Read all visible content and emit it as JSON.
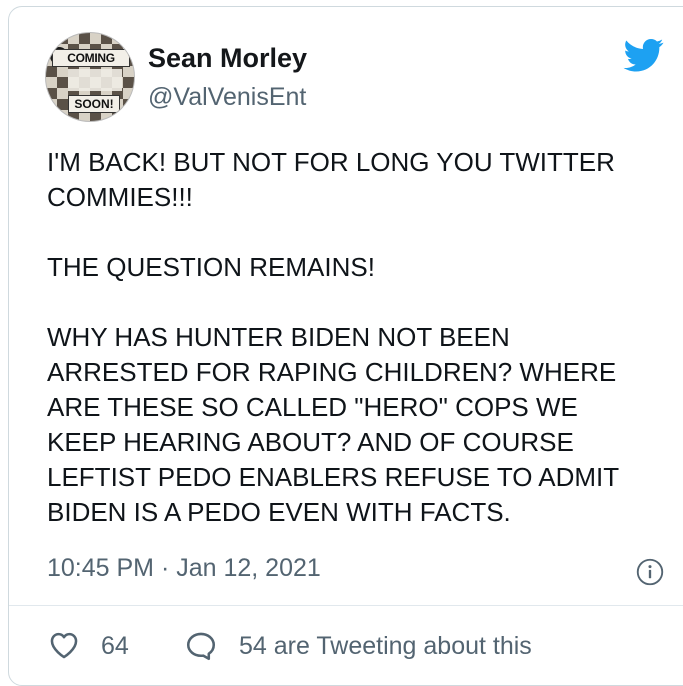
{
  "author": {
    "name": "Sean Morley",
    "handle": "@ValVenisEnt",
    "avatar_text_top": "COMING",
    "avatar_text_bottom": "SOON!"
  },
  "tweet": {
    "text": "I'M BACK! BUT NOT FOR LONG YOU TWITTER\nCOMMIES!!!\n\nTHE QUESTION REMAINS!\n\nWHY HAS HUNTER BIDEN NOT BEEN\nARRESTED FOR RAPING CHILDREN? WHERE\nARE THESE SO CALLED \"HERO\" COPS WE\nKEEP HEARING ABOUT? AND OF COURSE\nLEFTIST PEDO ENABLERS REFUSE TO ADMIT\nBIDEN IS A PEDO EVEN  WITH FACTS.",
    "timestamp": "10:45 PM · Jan 12, 2021"
  },
  "actions": {
    "like_count": "64",
    "tweeting_text": "54 are Tweeting about this"
  },
  "icons": {
    "brand": "twitter-bird-icon",
    "info": "info-icon",
    "like": "heart-icon",
    "reply": "speech-bubble-icon"
  },
  "colors": {
    "brand": "#1DA1F2",
    "secondary_text": "#536471",
    "border": "#cfd9de"
  }
}
